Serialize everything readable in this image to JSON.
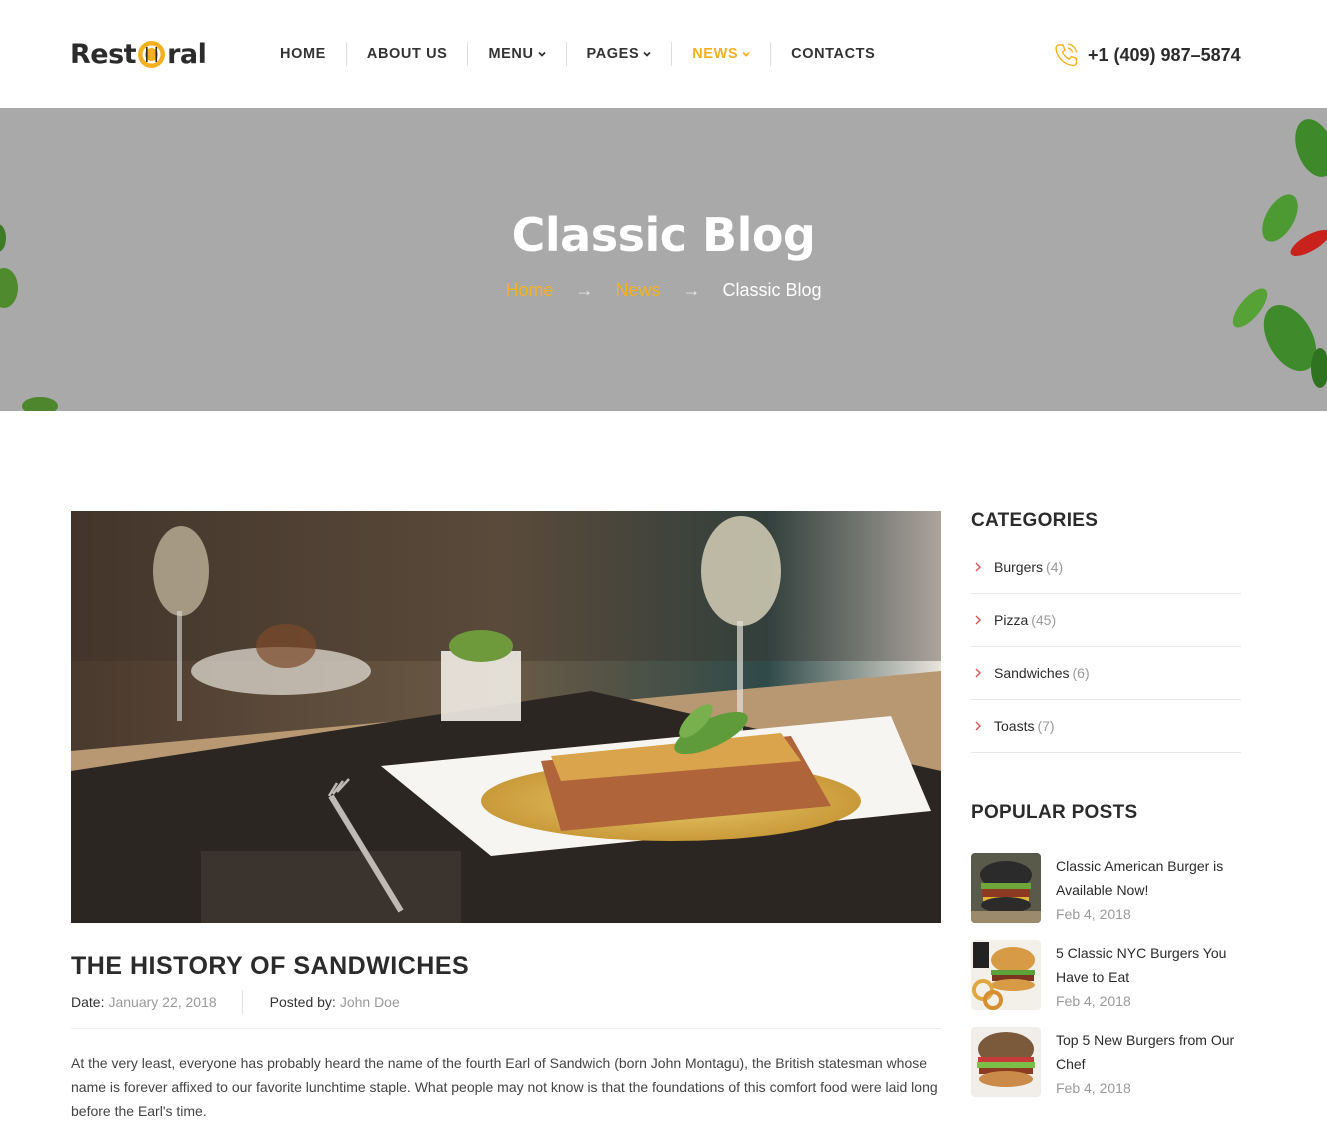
{
  "brand": {
    "logo_left": "Rest",
    "logo_right": "ral",
    "accent": "#f3b122"
  },
  "nav": {
    "items": [
      {
        "label": "HOME",
        "dropdown": false,
        "active": false
      },
      {
        "label": "ABOUT US",
        "dropdown": false,
        "active": false
      },
      {
        "label": "MENU",
        "dropdown": true,
        "active": false
      },
      {
        "label": "PAGES",
        "dropdown": true,
        "active": false
      },
      {
        "label": "NEWS",
        "dropdown": true,
        "active": true
      },
      {
        "label": "CONTACTS",
        "dropdown": false,
        "active": false
      }
    ]
  },
  "phone": {
    "number": "+1 (409) 987–5874",
    "icon": "phone-icon"
  },
  "hero": {
    "title": "Classic Blog",
    "breadcrumb": [
      {
        "label": "Home",
        "link": true
      },
      {
        "label": "News",
        "link": true
      },
      {
        "label": "Classic Blog",
        "link": false
      }
    ],
    "separator": "→"
  },
  "post": {
    "title": "THE HISTORY OF SANDWICHES",
    "date_label": "Date:",
    "date": "January 22, 2018",
    "author_label": "Posted by:",
    "author": "John Doe",
    "excerpt": "At the very least, everyone has probably heard the name of the fourth Earl of Sandwich (born John Montagu), the British statesman whose name is forever affixed to our favorite lunchtime staple. What people may not know is that the foundations of this comfort food were laid long before the Earl's time."
  },
  "sidebar": {
    "categories_heading": "CATEGORIES",
    "categories": [
      {
        "name": "Burgers",
        "count": "(4)"
      },
      {
        "name": "Pizza",
        "count": "(45)"
      },
      {
        "name": "Sandwiches",
        "count": "(6)"
      },
      {
        "name": "Toasts",
        "count": "(7)"
      }
    ],
    "popular_heading": "POPULAR POSTS",
    "popular": [
      {
        "title": "Classic American Burger is Available Now!",
        "date": "Feb 4, 2018"
      },
      {
        "title": "5 Classic NYC Burgers You Have to Eat",
        "date": "Feb 4, 2018"
      },
      {
        "title": "Top 5 New Burgers from Our Chef",
        "date": "Feb 4, 2018"
      }
    ]
  }
}
